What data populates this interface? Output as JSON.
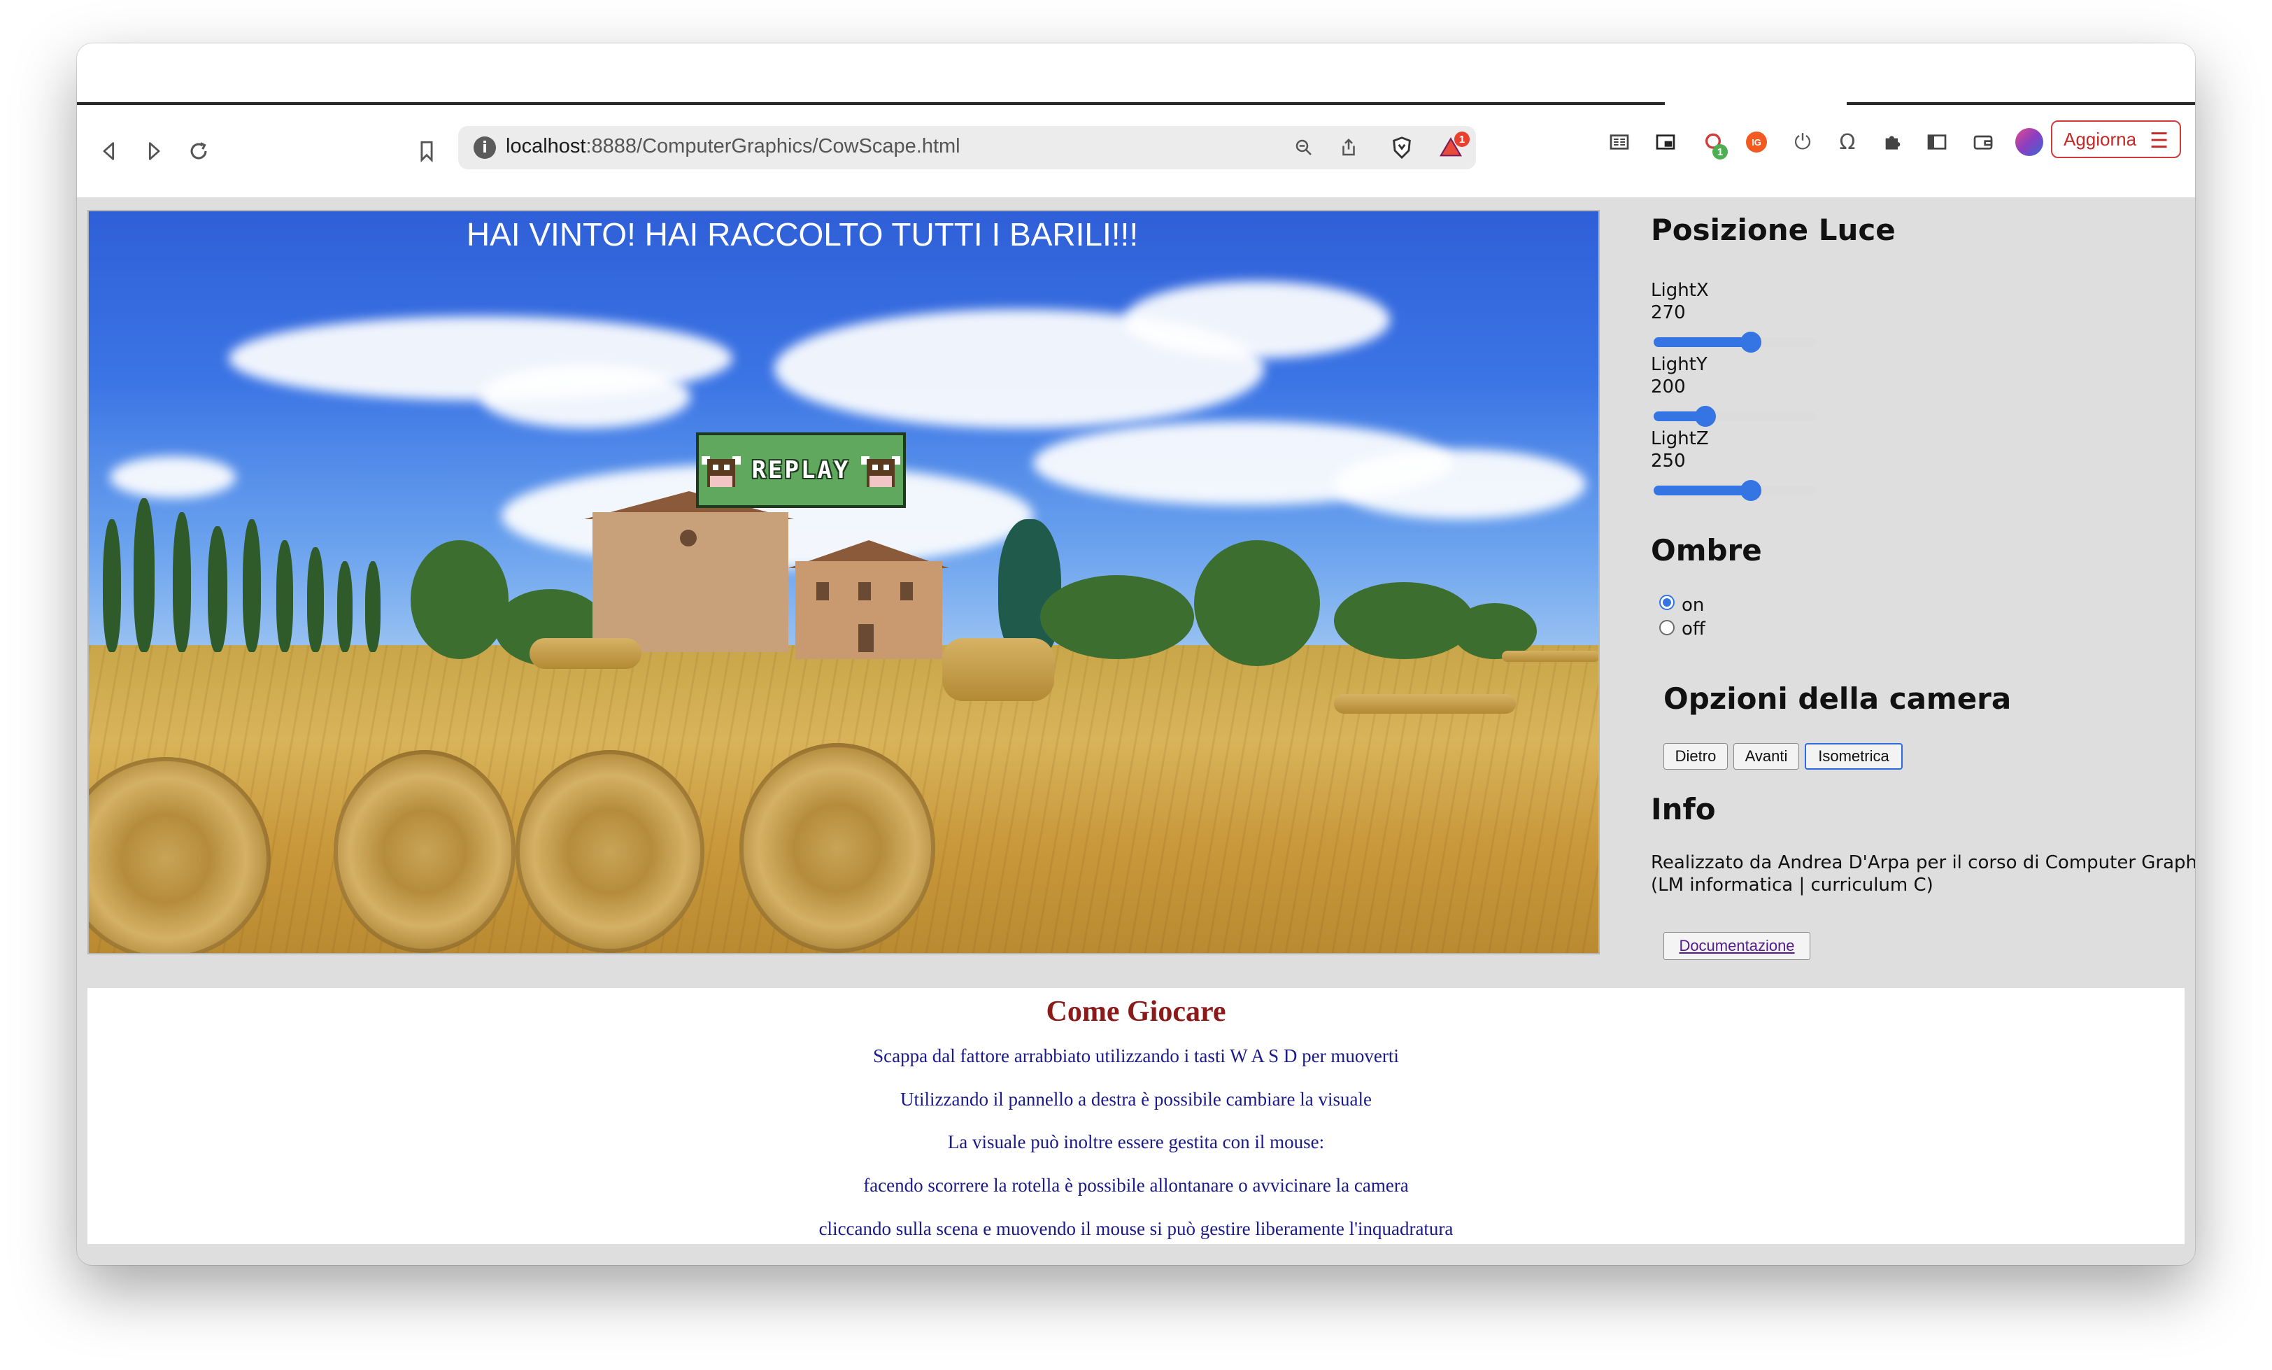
{
  "browser": {
    "url_host": "localhost",
    "url_rest": ":8888/ComputerGraphics/CowScape.html",
    "update_button": "Aggiorna",
    "brave_alert_badge": "1",
    "extension_badge": "1",
    "nav_icons": [
      "back-icon",
      "forward-icon",
      "reload-icon",
      "bookmark-icon"
    ],
    "url_icons": [
      "zoom-icon",
      "share-icon",
      "brave-shield-icon",
      "brave-rewards-icon"
    ]
  },
  "scene": {
    "win_message": "HAI VINTO! HAI RACCOLTO TUTTI I BARILI!!!",
    "replay_label": "REPLAY"
  },
  "panel": {
    "light_title": "Posizione Luce",
    "lights": [
      {
        "label": "LightX",
        "value": "270",
        "fraction": 0.6
      },
      {
        "label": "LightY",
        "value": "200",
        "fraction": 0.32
      },
      {
        "label": "LightZ",
        "value": "250",
        "fraction": 0.6
      }
    ],
    "shadows_title": "Ombre",
    "shadow_options": [
      {
        "label": "on",
        "checked": true
      },
      {
        "label": "off",
        "checked": false
      }
    ],
    "camera_title": "Opzioni della camera",
    "camera_buttons": [
      {
        "label": "Dietro",
        "selected": false
      },
      {
        "label": "Avanti",
        "selected": false
      },
      {
        "label": "Isometrica",
        "selected": true
      }
    ],
    "info_title": "Info",
    "info_text_1": "Realizzato da Andrea D'Arpa per il corso di Computer Graphics",
    "info_text_2": "(LM informatica | curriculum C)",
    "doc_button": "Documentazione"
  },
  "howto": {
    "title": "Come Giocare",
    "lines": [
      "Scappa dal fattore arrabbiato utilizzando i tasti W A S D per muoverti",
      "Utilizzando il pannello a destra è possibile cambiare la visuale",
      "La visuale può inoltre essere gestita con il mouse:",
      "facendo scorrere la rotella è possibile allontanare o avvicinare la camera",
      "cliccando sulla scena e muovendo il mouse si può gestire liberamente l'inquadratura"
    ]
  },
  "colors": {
    "accent": "#3574e3",
    "howto_title": "#8b1a1a",
    "howto_text": "#1a1a8a",
    "update_red": "#c62828",
    "replay_green": "#5fa85d"
  }
}
